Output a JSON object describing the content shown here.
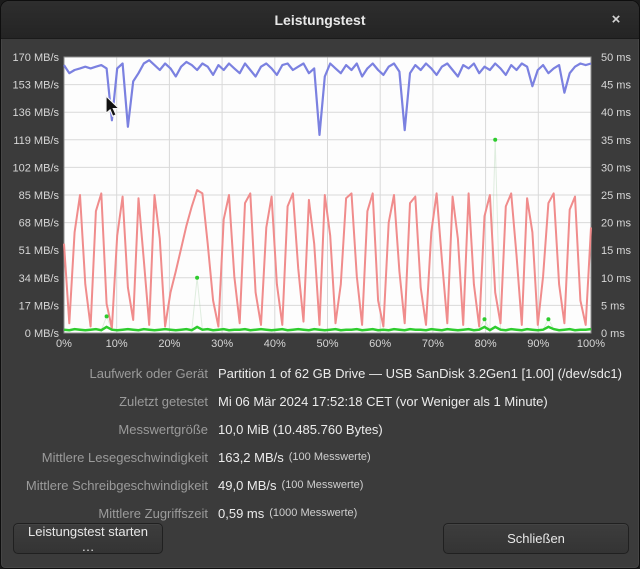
{
  "window": {
    "title": "Leistungstest",
    "close_glyph": "×"
  },
  "chart": {
    "left_axis": {
      "labels": [
        "170 MB/s",
        "153 MB/s",
        "136 MB/s",
        "119 MB/s",
        "102 MB/s",
        "85 MB/s",
        "68 MB/s",
        "51 MB/s",
        "34 MB/s",
        "17 MB/s",
        "0 MB/s"
      ]
    },
    "right_axis": {
      "labels": [
        "50 ms",
        "45 ms",
        "40 ms",
        "35 ms",
        "30 ms",
        "25 ms",
        "20 ms",
        "15 ms",
        "10 ms",
        "5 ms",
        "0 ms"
      ]
    },
    "x_axis": {
      "labels": [
        "0%",
        "10%",
        "20%",
        "30%",
        "40%",
        "50%",
        "60%",
        "70%",
        "80%",
        "90%",
        "100%"
      ]
    },
    "colors": {
      "plot_bg": "#fdfdfd",
      "grid": "#d9d9d9",
      "frame": "#8f8f8f",
      "read": "#7b81e0",
      "write": "#f08c8c",
      "access": "#2ecc2e",
      "access_faint": "rgba(165,205,165,0.35)"
    }
  },
  "chart_data": {
    "type": "line",
    "title": "Leistungstest",
    "x_range_percent": [
      0,
      100
    ],
    "left_ylim": [
      0,
      170
    ],
    "left_ylabel": "MB/s",
    "right_ylim": [
      0,
      50
    ],
    "right_ylabel": "ms",
    "grid": true,
    "series": [
      {
        "name": "read_mbps",
        "axis": "left",
        "color": "#7b81e0",
        "values": [
          165,
          160,
          162,
          163,
          164,
          163,
          164,
          165,
          163,
          131,
          163,
          166,
          127,
          155,
          160,
          166,
          168,
          165,
          162,
          166,
          163,
          158,
          164,
          167,
          165,
          162,
          166,
          164,
          159,
          165,
          162,
          166,
          163,
          160,
          166,
          162,
          158,
          164,
          166,
          163,
          159,
          165,
          166,
          162,
          164,
          166,
          160,
          163,
          122,
          158,
          166,
          163,
          160,
          165,
          162,
          166,
          158,
          163,
          166,
          162,
          159,
          164,
          166,
          161,
          125,
          160,
          165,
          162,
          166,
          163,
          159,
          164,
          166,
          162,
          158,
          165,
          163,
          166,
          160,
          164,
          162,
          166,
          163,
          159,
          165,
          162,
          166,
          164,
          152,
          162,
          165,
          160,
          163,
          165,
          148,
          160,
          164,
          166,
          165,
          166
        ]
      },
      {
        "name": "write_mbps",
        "axis": "left",
        "color": "#f08c8c",
        "values": [
          55,
          6,
          62,
          85,
          30,
          4,
          75,
          86,
          18,
          3,
          60,
          84,
          28,
          8,
          83,
          45,
          5,
          85,
          58,
          4,
          25,
          38,
          52,
          66,
          78,
          88,
          86,
          55,
          20,
          4,
          70,
          85,
          35,
          6,
          80,
          86,
          25,
          5,
          65,
          84,
          30,
          5,
          78,
          86,
          40,
          7,
          82,
          55,
          5,
          85,
          60,
          6,
          30,
          83,
          86,
          35,
          5,
          75,
          86,
          20,
          4,
          68,
          85,
          38,
          6,
          80,
          84,
          28,
          5,
          62,
          86,
          45,
          6,
          84,
          58,
          5,
          86,
          30,
          4,
          72,
          85,
          25,
          6,
          78,
          86,
          48,
          5,
          83,
          62,
          5,
          35,
          80,
          86,
          30,
          6,
          76,
          84,
          20,
          5,
          65
        ]
      },
      {
        "name": "access_ms",
        "axis": "right",
        "color": "#2ecc2e",
        "values": [
          0.6,
          0.5,
          0.7,
          0.6,
          0.5,
          0.6,
          0.7,
          0.5,
          3,
          0.6,
          0.5,
          0.6,
          0.7,
          0.6,
          0.5,
          0.7,
          0.6,
          0.5,
          0.6,
          0.7,
          0.6,
          0.5,
          0.6,
          0.7,
          0.5,
          10,
          0.6,
          0.7,
          0.5,
          0.6,
          0.7,
          0.5,
          0.6,
          0.6,
          0.7,
          0.5,
          0.6,
          0.7,
          0.6,
          0.5,
          0.6,
          0.7,
          0.5,
          0.6,
          0.7,
          0.6,
          0.5,
          0.7,
          0.6,
          0.5,
          0.6,
          0.7,
          0.5,
          0.6,
          0.6,
          0.7,
          0.5,
          0.6,
          0.7,
          0.5,
          0.6,
          0.5,
          0.7,
          0.6,
          0.5,
          0.7,
          0.6,
          0.6,
          0.5,
          0.7,
          0.6,
          0.5,
          0.7,
          0.6,
          0.5,
          0.6,
          0.7,
          0.5,
          0.6,
          2.5,
          0.5,
          35,
          0.6,
          0.5,
          0.7,
          0.6,
          0.5,
          0.7,
          0.6,
          0.5,
          0.6,
          2.5,
          0.7,
          0.5,
          0.6,
          0.7,
          0.5,
          0.6,
          0.6,
          0.7
        ]
      }
    ],
    "summary": {
      "average_read": "163,2 MB/s",
      "average_write": "49,0 MB/s",
      "average_access_time": "0,59 ms"
    }
  },
  "details": {
    "rows": [
      {
        "label": "Laufwerk oder Gerät",
        "value": "Partition 1 of 62 GB Drive — USB SanDisk 3.2Gen1 [1.00] (/dev/sdc1)",
        "note": ""
      },
      {
        "label": "Zuletzt getestet",
        "value": "Mi 06 Mär 2024 17:52:18 CET (vor Weniger als 1 Minute)",
        "note": ""
      },
      {
        "label": "Messwertgröße",
        "value": "10,0 MiB (10.485.760 Bytes)",
        "note": ""
      },
      {
        "label": "Mittlere Lesegeschwindigkeit",
        "value": "163,2 MB/s",
        "note": "(100 Messwerte)"
      },
      {
        "label": "Mittlere Schreibgeschwindigkeit",
        "value": "49,0 MB/s",
        "note": "(100 Messwerte)"
      },
      {
        "label": "Mittlere Zugriffszeit",
        "value": "0,59 ms",
        "note": "(1000 Messwerte)"
      }
    ]
  },
  "buttons": {
    "start": "Leistungstest starten …",
    "close": "Schließen"
  }
}
